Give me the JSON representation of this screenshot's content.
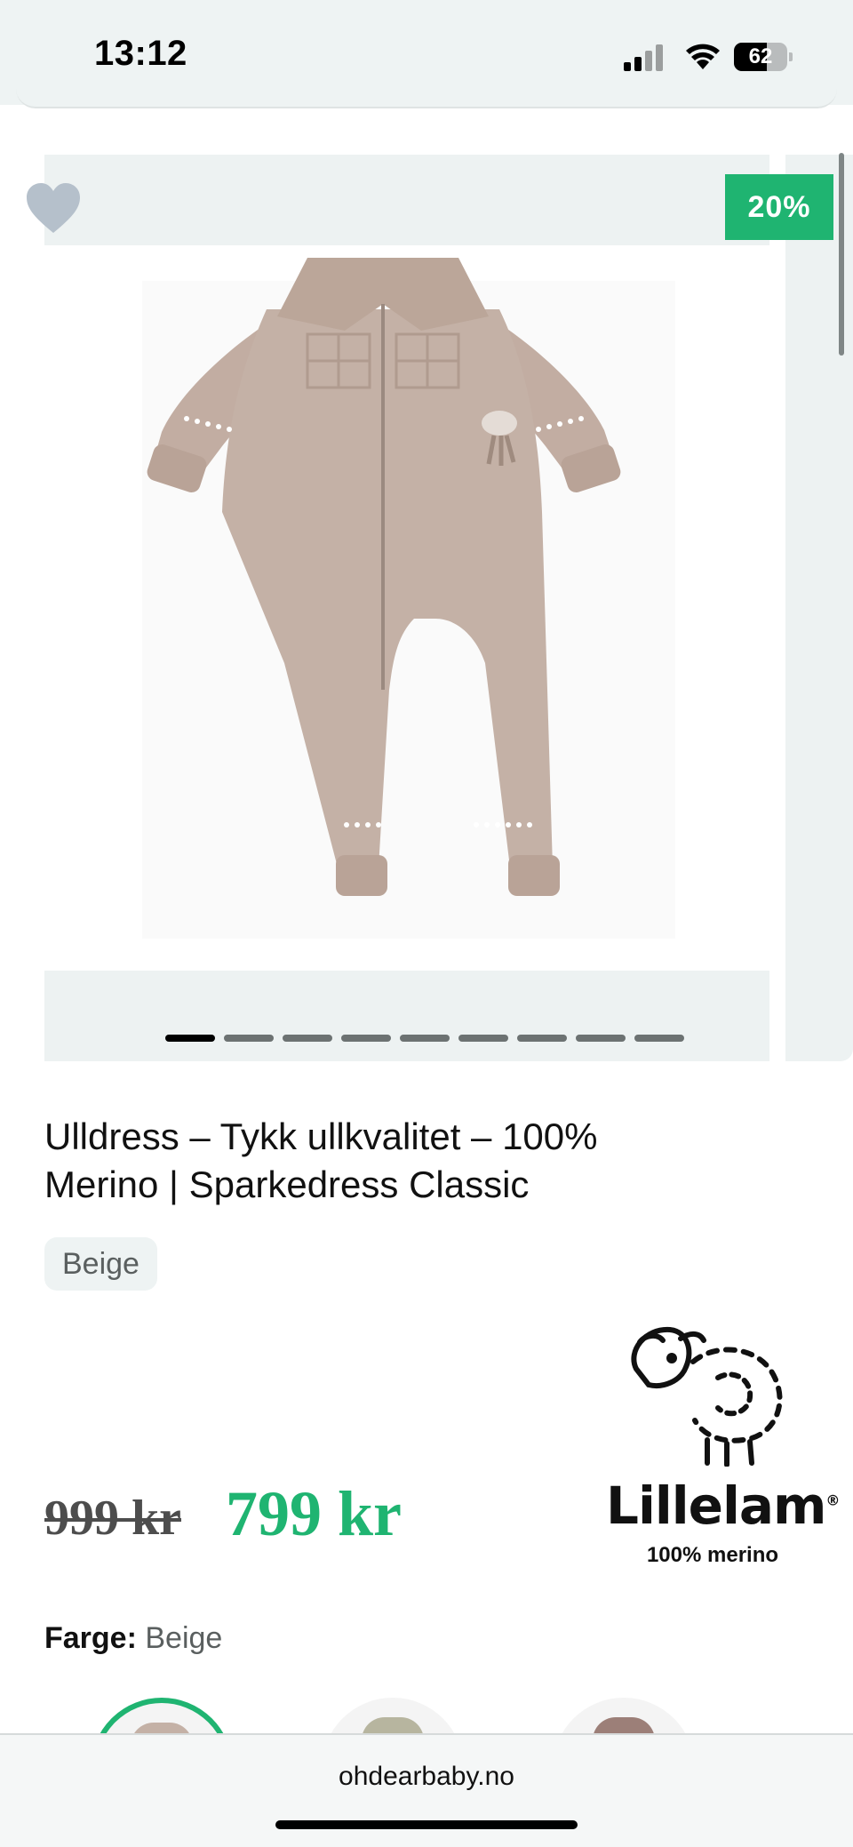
{
  "status_bar": {
    "time": "13:12",
    "battery_level": "62",
    "battery_fraction": 0.62,
    "signal_bars_active": 2,
    "icons": [
      "signal-icon",
      "wifi-icon",
      "battery-icon"
    ]
  },
  "gallery": {
    "discount_badge": "20%",
    "favorite_icon": "heart-icon",
    "image_count": 9,
    "active_image_index": 0
  },
  "product": {
    "title": "Ulldress – Tykk ullkvalitet – 100% Merino | Sparkedress Classic",
    "variant_chip": "Beige",
    "price_old": "999 kr",
    "price_new": "799 kr"
  },
  "brand": {
    "name": "Lillelam",
    "registered_mark": "®",
    "tagline": "100% merino",
    "logo_icon": "sheep-icon"
  },
  "color_selector": {
    "label": "Farge:",
    "selected_value": "Beige",
    "swatches": [
      {
        "name": "beige",
        "color": "#c4b1a6",
        "selected": true
      },
      {
        "name": "sage",
        "color": "#b7b59f",
        "selected": false
      },
      {
        "name": "mauve",
        "color": "#9c7f78",
        "selected": false
      }
    ]
  },
  "browser": {
    "url": "ohdearbaby.no"
  },
  "colors": {
    "accent_green": "#1fb471",
    "surface": "#eef3f3",
    "heart": "#b5c0cb",
    "garment": "#c4b1a6"
  }
}
